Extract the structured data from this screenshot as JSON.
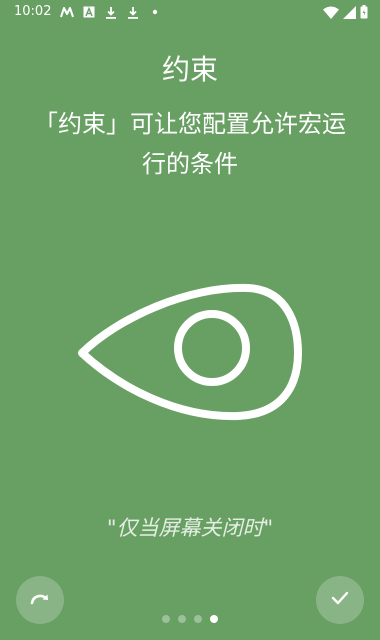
{
  "status_bar": {
    "time": "10:02",
    "left_icons": [
      "m-notification-icon",
      "a-notification-icon",
      "download-icon",
      "download-icon",
      "dot-icon"
    ],
    "right_icons": [
      "wifi-icon",
      "signal-icon",
      "battery-icon"
    ]
  },
  "intro": {
    "title": "约束",
    "description": "「约束」可让您配置允许宏运行的条件",
    "example": "\"仅当屏幕关闭时\"",
    "illustration_icon": "eye-icon"
  },
  "controls": {
    "skip_icon": "redo-arrow-icon",
    "done_icon": "check-icon"
  },
  "pager": {
    "total_pages": 4,
    "current_page": 4
  },
  "colors": {
    "background": "#689f63",
    "foreground": "#ffffff"
  }
}
